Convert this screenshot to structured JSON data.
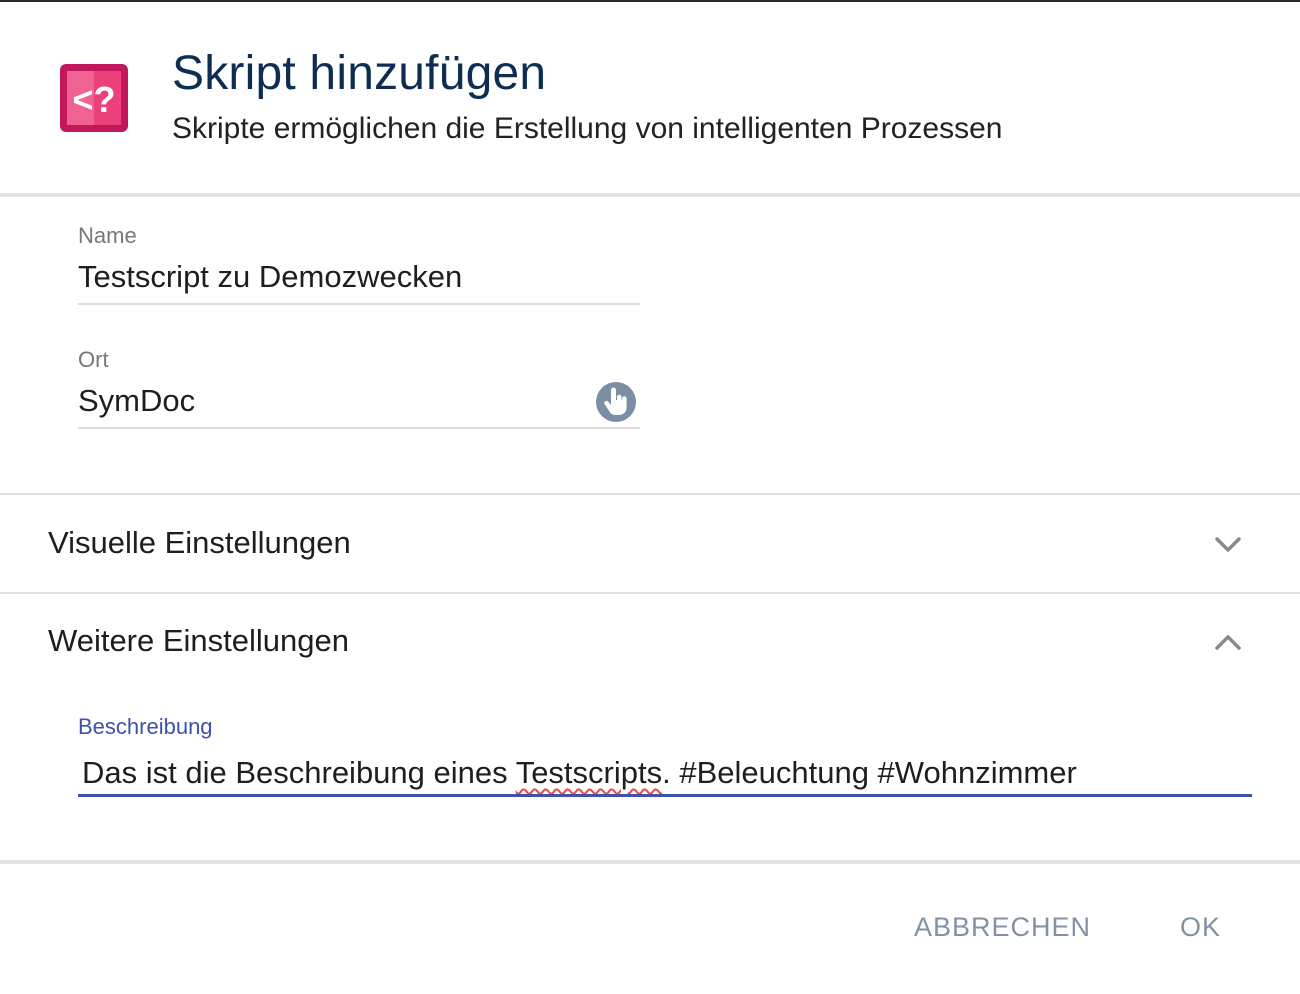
{
  "header": {
    "title": "Skript hinzufügen",
    "subtitle": "Skripte ermöglichen die Erstellung von intelligenten Prozessen",
    "icon": "script-code-icon",
    "icon_color": "#c2185b"
  },
  "fields": {
    "name": {
      "label": "Name",
      "value": "Testscript zu Demozwecken"
    },
    "location": {
      "label": "Ort",
      "value": "SymDoc",
      "picker_icon": "touch-pointer-icon"
    }
  },
  "sections": {
    "visual": {
      "title": "Visuelle Einstellungen",
      "expanded": false
    },
    "further": {
      "title": "Weitere Einstellungen",
      "expanded": true
    }
  },
  "description": {
    "label": "Beschreibung",
    "text_before": "Das ist die Beschreibung eines ",
    "misspelled": "Testscripts",
    "text_after": ". #Beleuchtung #Wohnzimmer",
    "accent_color": "#3d52a8"
  },
  "footer": {
    "cancel_label": "ABBRECHEN",
    "ok_label": "OK"
  }
}
